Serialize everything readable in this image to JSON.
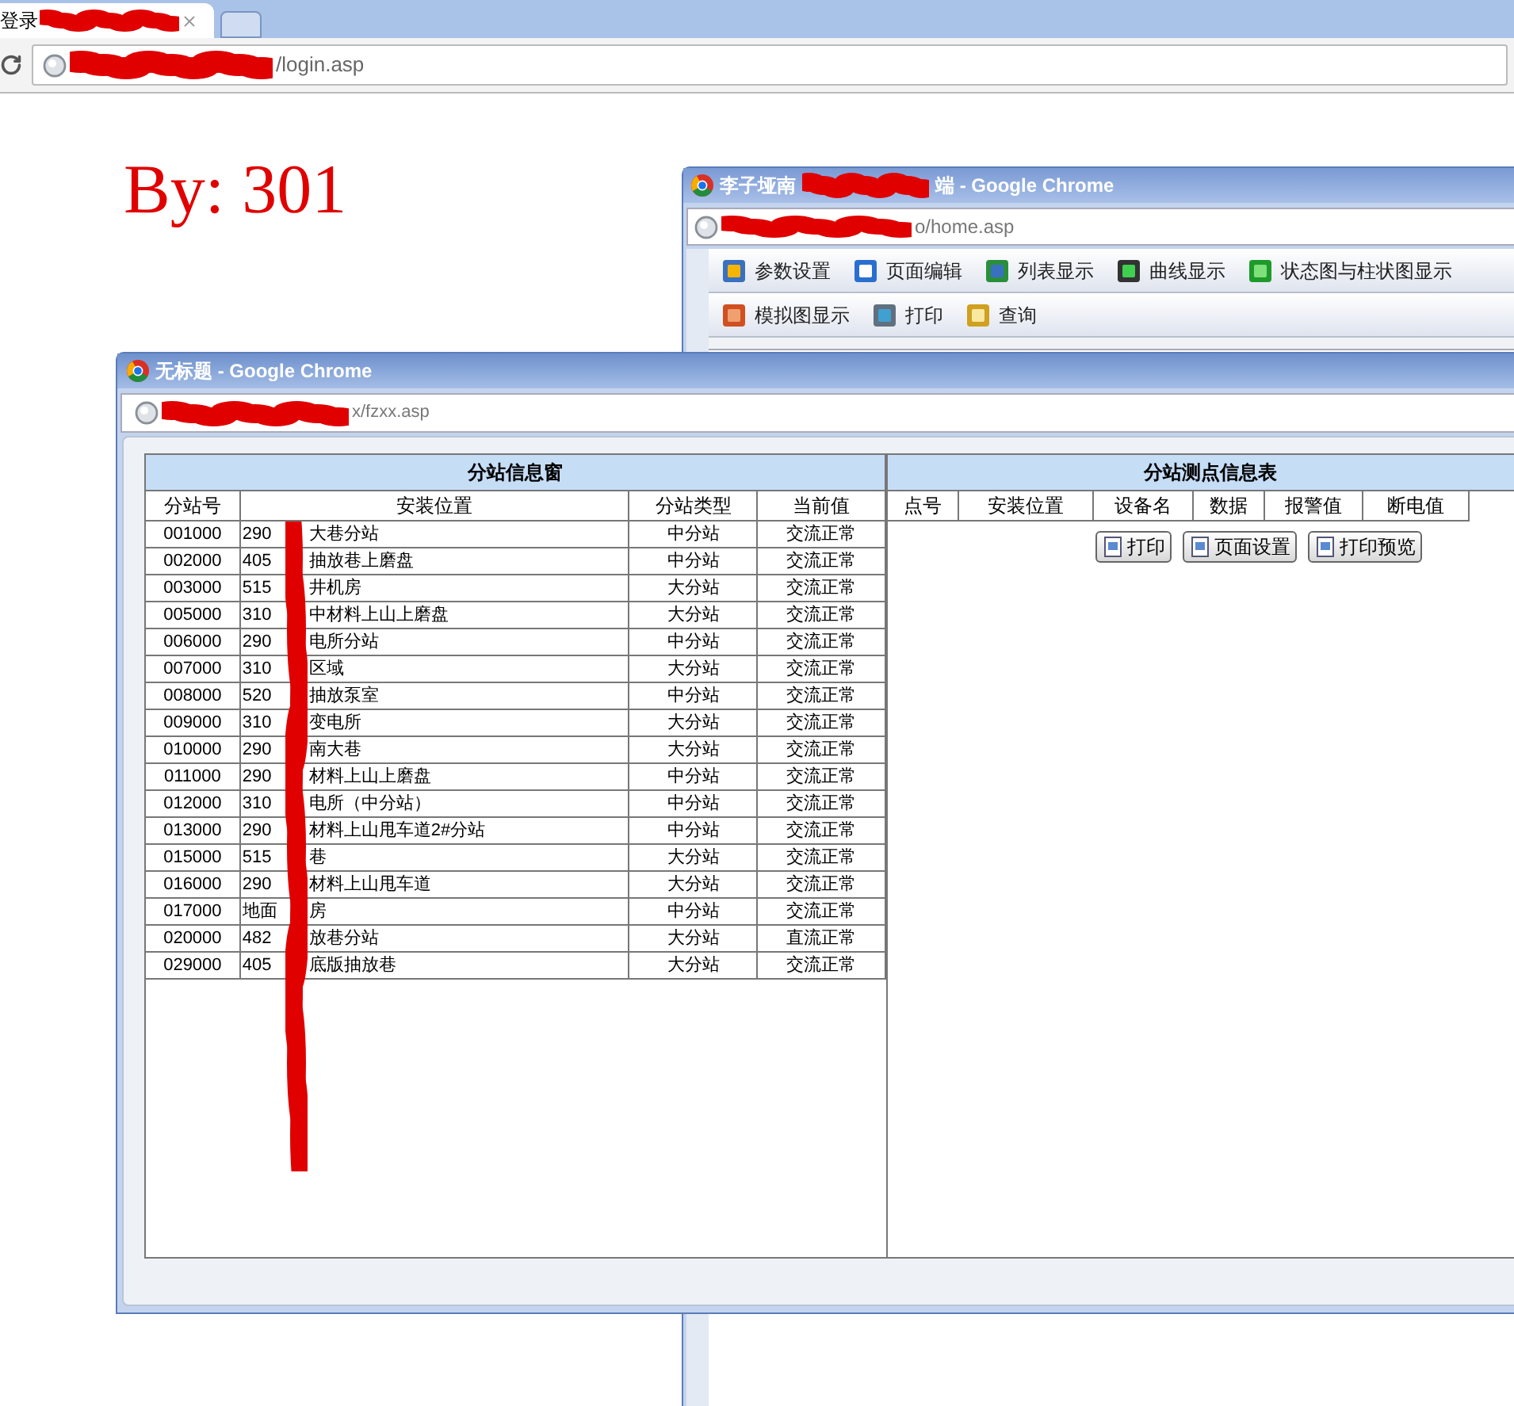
{
  "browser": {
    "tab_title": "登录",
    "address": "/login.asp"
  },
  "page": {
    "heading": "By: 301"
  },
  "window_back": {
    "title_start": "李子垭南",
    "title_end": "端 - Google Chrome",
    "address": "o/home.asp",
    "toolbar_rows": [
      [
        "参数设置",
        "页面编辑",
        "列表显示",
        "曲线显示",
        "状态图与柱状图显示"
      ],
      [
        "模拟图显示",
        "打印",
        "查询"
      ]
    ]
  },
  "window_front": {
    "title": "无标题 - Google Chrome",
    "address": "x/fzxx.asp",
    "station_table": {
      "title": "分站信息窗",
      "columns": [
        "分站号",
        "安装位置",
        "分站类型",
        "当前值"
      ],
      "rows": [
        {
          "id": "001000",
          "location_start": "290",
          "location_end": "大巷分站",
          "type": "中分站",
          "value": "交流正常"
        },
        {
          "id": "002000",
          "location_start": "405",
          "location_end": "抽放巷上磨盘",
          "type": "中分站",
          "value": "交流正常"
        },
        {
          "id": "003000",
          "location_start": "515",
          "location_end": "井机房",
          "type": "大分站",
          "value": "交流正常"
        },
        {
          "id": "005000",
          "location_start": "310",
          "location_end": "中材料上山上磨盘",
          "type": "大分站",
          "value": "交流正常"
        },
        {
          "id": "006000",
          "location_start": "290",
          "location_end": "电所分站",
          "type": "中分站",
          "value": "交流正常"
        },
        {
          "id": "007000",
          "location_start": "310",
          "location_end": "区域",
          "type": "大分站",
          "value": "交流正常"
        },
        {
          "id": "008000",
          "location_start": "520",
          "location_end": "抽放泵室",
          "type": "中分站",
          "value": "交流正常"
        },
        {
          "id": "009000",
          "location_start": "310",
          "location_end": "变电所",
          "type": "大分站",
          "value": "交流正常"
        },
        {
          "id": "010000",
          "location_start": "290",
          "location_end": "南大巷",
          "type": "大分站",
          "value": "交流正常"
        },
        {
          "id": "011000",
          "location_start": "290",
          "location_end": "材料上山上磨盘",
          "type": "中分站",
          "value": "交流正常"
        },
        {
          "id": "012000",
          "location_start": "310",
          "location_end": "电所（中分站）",
          "type": "中分站",
          "value": "交流正常"
        },
        {
          "id": "013000",
          "location_start": "290",
          "location_end": "材料上山甩车道2#分站",
          "type": "中分站",
          "value": "交流正常"
        },
        {
          "id": "015000",
          "location_start": "515",
          "location_end": "巷",
          "type": "大分站",
          "value": "交流正常"
        },
        {
          "id": "016000",
          "location_start": "290",
          "location_end": "材料上山甩车道",
          "type": "大分站",
          "value": "交流正常"
        },
        {
          "id": "017000",
          "location_start": "地面",
          "location_end": "房",
          "type": "中分站",
          "value": "交流正常"
        },
        {
          "id": "020000",
          "location_start": "482",
          "location_end": "放巷分站",
          "type": "大分站",
          "value": "直流正常"
        },
        {
          "id": "029000",
          "location_start": "405",
          "location_end": "底版抽放巷",
          "type": "大分站",
          "value": "交流正常"
        }
      ]
    },
    "point_table": {
      "title": "分站测点信息表",
      "columns": [
        "点号",
        "安装位置",
        "设备名",
        "数据",
        "报警值",
        "断电值"
      ],
      "buttons": [
        "打印",
        "页面设置",
        "打印预览"
      ]
    }
  }
}
